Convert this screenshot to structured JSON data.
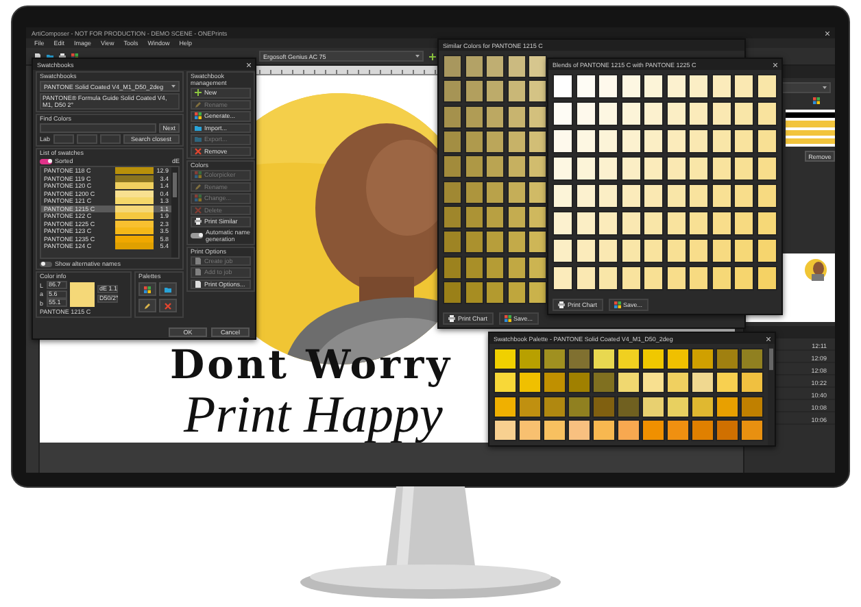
{
  "app": {
    "title": "ArtiComposer - NOT FOR PRODUCTION - DEMO SCENE - ONEPrints",
    "menu": [
      "File",
      "Edit",
      "Image",
      "View",
      "Tools",
      "Window",
      "Help"
    ],
    "printer": "Ergosoft Genius AC 75"
  },
  "swatchbooks_dialog": {
    "title": "Swatchbooks",
    "group_label": "Swatchbooks",
    "book": "PANTONE Solid Coated V4_M1_D50_2deg",
    "description": "PANTONE® Formula Guide Solid Coated V4, M1, D50 2°",
    "find_label": "Find Colors",
    "next": "Next",
    "lab_label": "Lab",
    "search_closest": "Search closest",
    "list_label": "List of swatches",
    "sorted_toggle": {
      "on": true,
      "label": "Sorted"
    },
    "de_header": "dE",
    "swatches": [
      {
        "name": "PANTONE 118 C",
        "de": "12.9",
        "color": "#b8900a",
        "selected": false
      },
      {
        "name": "PANTONE 119 C",
        "de": "3.4",
        "color": "#8a7420",
        "selected": false
      },
      {
        "name": "PANTONE 120 C",
        "de": "1.4",
        "color": "#f0d060",
        "selected": false
      },
      {
        "name": "PANTONE 1200 C",
        "de": "0.4",
        "color": "#f8e090",
        "selected": false
      },
      {
        "name": "PANTONE 121 C",
        "de": "1.3",
        "color": "#f5d86a",
        "selected": false
      },
      {
        "name": "PANTONE 1215 C",
        "de": "1.1",
        "color": "#f5d878",
        "selected": true
      },
      {
        "name": "PANTONE 122 C",
        "de": "1.9",
        "color": "#f5c840",
        "selected": false
      },
      {
        "name": "PANTONE 1225 C",
        "de": "2.3",
        "color": "#f8c030",
        "selected": false
      },
      {
        "name": "PANTONE 123 C",
        "de": "3.5",
        "color": "#f5b818",
        "selected": false
      },
      {
        "name": "PANTONE 1235 C",
        "de": "5.8",
        "color": "#f0a800",
        "selected": false
      },
      {
        "name": "PANTONE 124 C",
        "de": "5.4",
        "color": "#e0a000",
        "selected": false
      }
    ],
    "alt_names": {
      "on": false,
      "label": "Show alternative names"
    },
    "color_info": {
      "label": "Color info",
      "fields": [
        {
          "label": "L",
          "value": "86.7"
        },
        {
          "label": "a",
          "value": "5.6"
        },
        {
          "label": "b",
          "value": "55.1"
        }
      ],
      "de": "dE 1.1",
      "illuminant": "D50/2°",
      "name": "PANTONE 1215 C",
      "color": "#f5d878"
    },
    "palettes_label": "Palettes",
    "management": {
      "label": "Swatchbook management",
      "buttons": [
        {
          "label": "New",
          "disabled": false,
          "kind": "plus"
        },
        {
          "label": "Rename",
          "disabled": true,
          "kind": "pencil"
        },
        {
          "label": "Generate...",
          "disabled": false,
          "kind": "grid"
        },
        {
          "label": "Import...",
          "disabled": false,
          "kind": "folder"
        },
        {
          "label": "Export...",
          "disabled": true,
          "kind": "folder"
        },
        {
          "label": "Remove",
          "disabled": false,
          "kind": "cross"
        }
      ]
    },
    "colors": {
      "label": "Colors",
      "buttons": [
        {
          "label": "Colorpicker",
          "disabled": true,
          "kind": "grid"
        },
        {
          "label": "Rename",
          "disabled": true,
          "kind": "pencil"
        },
        {
          "label": "Change...",
          "disabled": true,
          "kind": "grid"
        },
        {
          "label": "Delete",
          "disabled": true,
          "kind": "cross"
        },
        {
          "label": "Print Similar",
          "disabled": false,
          "kind": "printer"
        }
      ],
      "auto_name": {
        "on": true,
        "label": "Automatic name generation"
      }
    },
    "print_options": {
      "label": "Print Options",
      "buttons": [
        {
          "label": "Create job",
          "disabled": true,
          "kind": "page"
        },
        {
          "label": "Add to job",
          "disabled": true,
          "kind": "page"
        },
        {
          "label": "Print Options...",
          "disabled": false,
          "kind": "page"
        }
      ]
    },
    "ok": "OK",
    "cancel": "Cancel"
  },
  "similar": {
    "title": "Similar Colors for PANTONE 1215 C",
    "rows": [
      [
        {
          "color": "#a8975e"
        },
        {
          "color": "#b3a266"
        },
        {
          "color": "#bfae72"
        },
        {
          "color": "#cbba80"
        },
        {
          "color": "#d6c68e"
        }
      ],
      [
        {
          "color": "#a69455"
        },
        {
          "color": "#b29f5e"
        },
        {
          "color": "#bdab6a"
        },
        {
          "color": "#c9b777"
        },
        {
          "color": "#d4c385"
        }
      ],
      [
        {
          "color": "#a5914c"
        },
        {
          "color": "#b09c55"
        },
        {
          "color": "#bca862"
        },
        {
          "color": "#c8b46f"
        },
        {
          "color": "#d3c07d"
        }
      ],
      [
        {
          "color": "#a38e43"
        },
        {
          "color": "#af9a4d"
        },
        {
          "color": "#bba65a"
        },
        {
          "color": "#c7b268"
        },
        {
          "color": "#d2be76"
        }
      ],
      [
        {
          "color": "#a28b3b"
        },
        {
          "color": "#ae9845"
        },
        {
          "color": "#baa452"
        },
        {
          "color": "#c6b060"
        },
        {
          "color": "#d1bc6e"
        }
      ],
      [
        {
          "color": "#a08833"
        },
        {
          "color": "#ad953d"
        },
        {
          "color": "#b9a24a"
        },
        {
          "color": "#c5ae58"
        },
        {
          "color": "#d0ba66"
        }
      ],
      [
        {
          "color": "#9f862b"
        },
        {
          "color": "#ac9335"
        },
        {
          "color": "#b8a042"
        },
        {
          "color": "#c4ac50"
        },
        {
          "color": "#cfb85e"
        }
      ],
      [
        {
          "color": "#9e8424"
        },
        {
          "color": "#ab912e"
        },
        {
          "color": "#b79e3b"
        },
        {
          "color": "#c3aa49"
        },
        {
          "color": "#ceb657"
        }
      ],
      [
        {
          "color": "#9c821e"
        },
        {
          "color": "#a98f28"
        },
        {
          "color": "#b59c35"
        },
        {
          "color": "#c1a843"
        },
        {
          "color": "#ccb451"
        }
      ],
      [
        {
          "color": "#9a8018"
        },
        {
          "color": "#a78d22"
        },
        {
          "color": "#b39a2f"
        },
        {
          "color": "#bfa63d"
        },
        {
          "color": "#cab24b"
        }
      ]
    ],
    "buttons": [
      {
        "label": "Print Chart",
        "kind": "printer"
      },
      {
        "label": "Save...",
        "kind": "grid"
      }
    ]
  },
  "blends": {
    "title": "Blends of PANTONE 1215 C with PANTONE 1225 C",
    "rows": [
      [
        {
          "color": "#ffffff"
        },
        {
          "color": "#fefcf5"
        },
        {
          "color": "#fef9ec"
        },
        {
          "color": "#fdf7e2"
        },
        {
          "color": "#fcf4d8"
        },
        {
          "color": "#fcf1cf"
        },
        {
          "color": "#fbeec5"
        },
        {
          "color": "#fbebbb"
        },
        {
          "color": "#fae8b2"
        },
        {
          "color": "#f9e6a8"
        }
      ],
      [
        {
          "color": "#fefcf5"
        },
        {
          "color": "#fef9ec"
        },
        {
          "color": "#fdf7e2"
        },
        {
          "color": "#fcf4d8"
        },
        {
          "color": "#fcf1cf"
        },
        {
          "color": "#fbeec5"
        },
        {
          "color": "#fbebbb"
        },
        {
          "color": "#fae8b2"
        },
        {
          "color": "#f9e6a8"
        },
        {
          "color": "#f9e39e"
        }
      ],
      [
        {
          "color": "#fef9ec"
        },
        {
          "color": "#fdf7e2"
        },
        {
          "color": "#fcf4d8"
        },
        {
          "color": "#fcf1cf"
        },
        {
          "color": "#fbeec5"
        },
        {
          "color": "#fbebbb"
        },
        {
          "color": "#fae8b2"
        },
        {
          "color": "#f9e6a8"
        },
        {
          "color": "#f9e39e"
        },
        {
          "color": "#f8e094"
        }
      ],
      [
        {
          "color": "#fdf7e2"
        },
        {
          "color": "#fcf4d8"
        },
        {
          "color": "#fcf1cf"
        },
        {
          "color": "#fbeec5"
        },
        {
          "color": "#fbebbb"
        },
        {
          "color": "#fae8b2"
        },
        {
          "color": "#f9e6a8"
        },
        {
          "color": "#f9e39e"
        },
        {
          "color": "#f8e094"
        },
        {
          "color": "#f8dd8b"
        }
      ],
      [
        {
          "color": "#fcf4d8"
        },
        {
          "color": "#fcf1cf"
        },
        {
          "color": "#fbeec5"
        },
        {
          "color": "#fbebbb"
        },
        {
          "color": "#fae8b2"
        },
        {
          "color": "#f9e6a8"
        },
        {
          "color": "#f9e39e"
        },
        {
          "color": "#f8e094"
        },
        {
          "color": "#f8dd8b"
        },
        {
          "color": "#f7da81"
        }
      ],
      [
        {
          "color": "#fcf1cf"
        },
        {
          "color": "#fbeec5"
        },
        {
          "color": "#fbebbb"
        },
        {
          "color": "#fae8b2"
        },
        {
          "color": "#f9e6a8"
        },
        {
          "color": "#f9e39e"
        },
        {
          "color": "#f8e094"
        },
        {
          "color": "#f8dd8b"
        },
        {
          "color": "#f7da81"
        },
        {
          "color": "#f6d877"
        }
      ],
      [
        {
          "color": "#fbeec5"
        },
        {
          "color": "#fbebbb"
        },
        {
          "color": "#fae8b2"
        },
        {
          "color": "#f9e6a8"
        },
        {
          "color": "#f9e39e"
        },
        {
          "color": "#f8e094"
        },
        {
          "color": "#f8dd8b"
        },
        {
          "color": "#f7da81"
        },
        {
          "color": "#f6d877"
        },
        {
          "color": "#f6d56e"
        }
      ],
      [
        {
          "color": "#fbebbb"
        },
        {
          "color": "#fae8b2"
        },
        {
          "color": "#f9e6a8"
        },
        {
          "color": "#f9e39e"
        },
        {
          "color": "#f8e094"
        },
        {
          "color": "#f8dd8b"
        },
        {
          "color": "#f7da81"
        },
        {
          "color": "#f6d877"
        },
        {
          "color": "#f6d56e"
        },
        {
          "color": "#f5d264"
        }
      ]
    ],
    "buttons": [
      {
        "label": "Print Chart",
        "kind": "printer"
      },
      {
        "label": "Save...",
        "kind": "grid"
      }
    ]
  },
  "palette": {
    "title": "Swatchbook Palette - PANTONE Solid Coated V4_M1_D50_2deg",
    "rows": [
      [
        {
          "color": "#f0d000"
        },
        {
          "color": "#b8a000"
        },
        {
          "color": "#a09020"
        },
        {
          "color": "#807030"
        },
        {
          "color": "#e8d850"
        },
        {
          "color": "#f0d020"
        },
        {
          "color": "#f0c800"
        },
        {
          "color": "#f0c000"
        },
        {
          "color": "#d0a000"
        },
        {
          "color": "#a08010"
        },
        {
          "color": "#908020"
        }
      ],
      [
        {
          "color": "#f8d838"
        },
        {
          "color": "#f0c000"
        },
        {
          "color": "#c09000"
        },
        {
          "color": "#a08000"
        },
        {
          "color": "#807020"
        },
        {
          "color": "#f0d870"
        },
        {
          "color": "#f8e090"
        },
        {
          "color": "#f0d060"
        },
        {
          "color": "#f0d890"
        },
        {
          "color": "#f8d050"
        },
        {
          "color": "#f0c040"
        }
      ],
      [
        {
          "color": "#f0b000"
        },
        {
          "color": "#c09010"
        },
        {
          "color": "#b08810"
        },
        {
          "color": "#908020"
        },
        {
          "color": "#806010"
        },
        {
          "color": "#706020"
        },
        {
          "color": "#e8d070"
        },
        {
          "color": "#e8d060"
        },
        {
          "color": "#e0b830"
        },
        {
          "color": "#e8a000"
        },
        {
          "color": "#c08000"
        }
      ],
      [
        {
          "color": "#f8d090"
        },
        {
          "color": "#f8c070"
        },
        {
          "color": "#f8c060"
        },
        {
          "color": "#f8c080"
        },
        {
          "color": "#f8b850"
        },
        {
          "color": "#f8a850"
        },
        {
          "color": "#f09000"
        },
        {
          "color": "#f09010"
        },
        {
          "color": "#e08000"
        },
        {
          "color": "#d07000"
        },
        {
          "color": "#e89010"
        }
      ]
    ]
  },
  "canvas": {
    "headline": "Dont Worry",
    "subline": "Print Happy"
  },
  "right_panel": {
    "button": "Remove",
    "times": [
      "12:11",
      "12:09",
      "12:08",
      "10:22",
      "10:40",
      "10:08",
      "10:06"
    ]
  }
}
